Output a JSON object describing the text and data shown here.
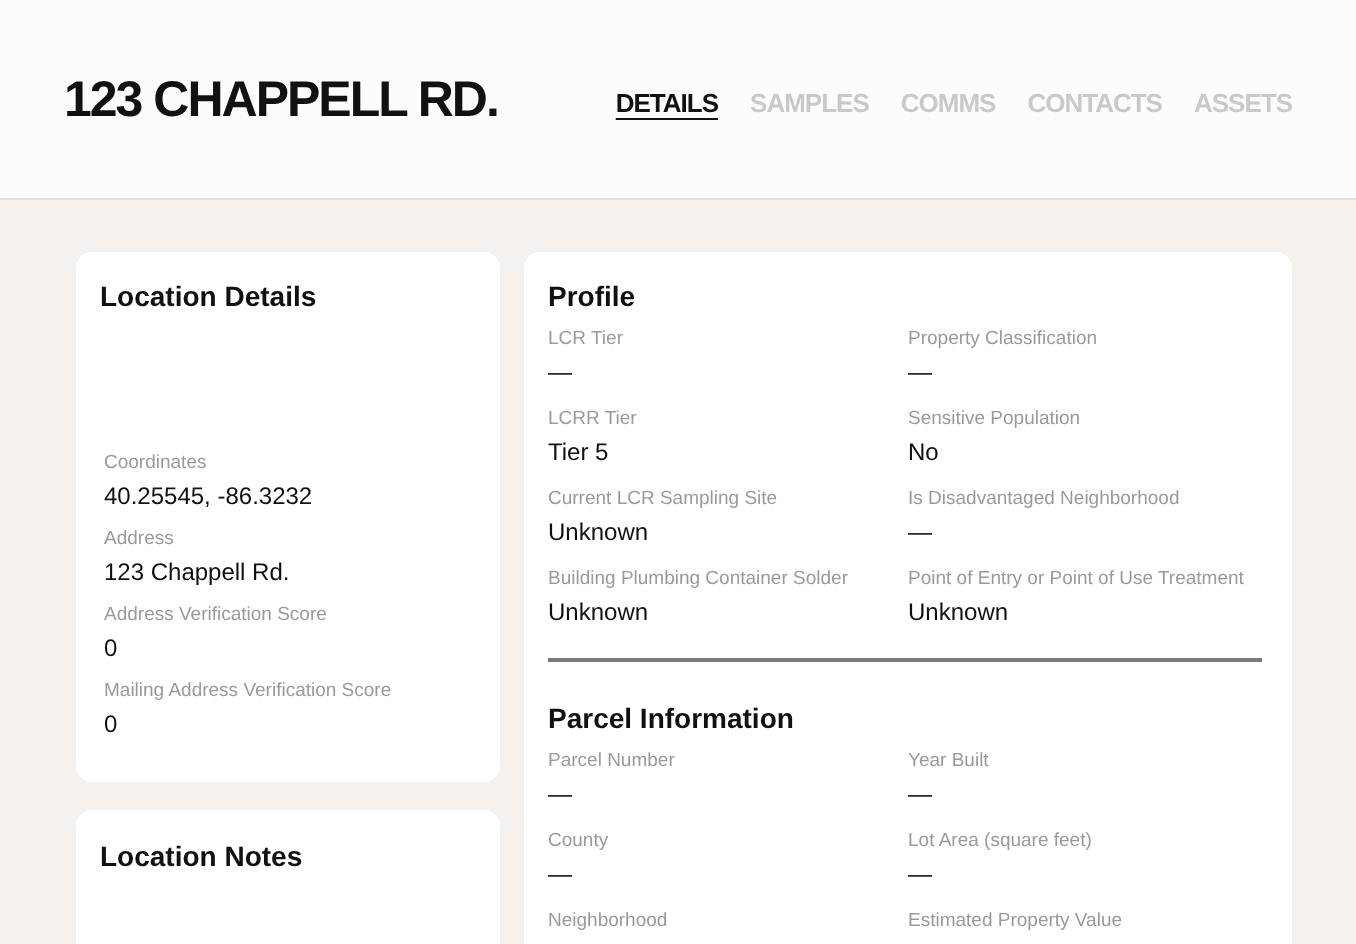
{
  "header": {
    "title": "123 CHAPPELL RD."
  },
  "tabs": [
    {
      "label": "DETAILS",
      "selected": true
    },
    {
      "label": "SAMPLES",
      "selected": false
    },
    {
      "label": "COMMS",
      "selected": false
    },
    {
      "label": "CONTACTS",
      "selected": false
    },
    {
      "label": "ASSETS",
      "selected": false
    }
  ],
  "location_details": {
    "title": "Location Details",
    "fields": [
      {
        "label": "Coordinates",
        "value": "40.25545, -86.3232"
      },
      {
        "label": "Address",
        "value": "123 Chappell Rd."
      },
      {
        "label": "Address Verification Score",
        "value": "0"
      },
      {
        "label": "Mailing Address Verification Score",
        "value": "0"
      }
    ]
  },
  "location_notes": {
    "title": "Location Notes"
  },
  "profile": {
    "title": "Profile",
    "fields": [
      {
        "label": "LCR Tier",
        "value": "—"
      },
      {
        "label": "Property Classification",
        "value": "—"
      },
      {
        "label": "LCRR Tier",
        "value": "Tier 5"
      },
      {
        "label": "Sensitive Population",
        "value": "No"
      },
      {
        "label": "Current LCR Sampling Site",
        "value": "Unknown"
      },
      {
        "label": "Is Disadvantaged Neighborhood",
        "value": "—"
      },
      {
        "label": "Building Plumbing Container Solder",
        "value": "Unknown"
      },
      {
        "label": "Point of Entry or Point of Use Treatment",
        "value": "Unknown"
      }
    ]
  },
  "parcel_information": {
    "title": "Parcel Information",
    "fields": [
      {
        "label": "Parcel Number",
        "value": "—"
      },
      {
        "label": "Year Built",
        "value": "—"
      },
      {
        "label": "County",
        "value": "—"
      },
      {
        "label": "Lot Area (square feet)",
        "value": "—"
      }
    ],
    "partial_labels": [
      "Neighborhood",
      "Estimated Property Value"
    ]
  }
}
